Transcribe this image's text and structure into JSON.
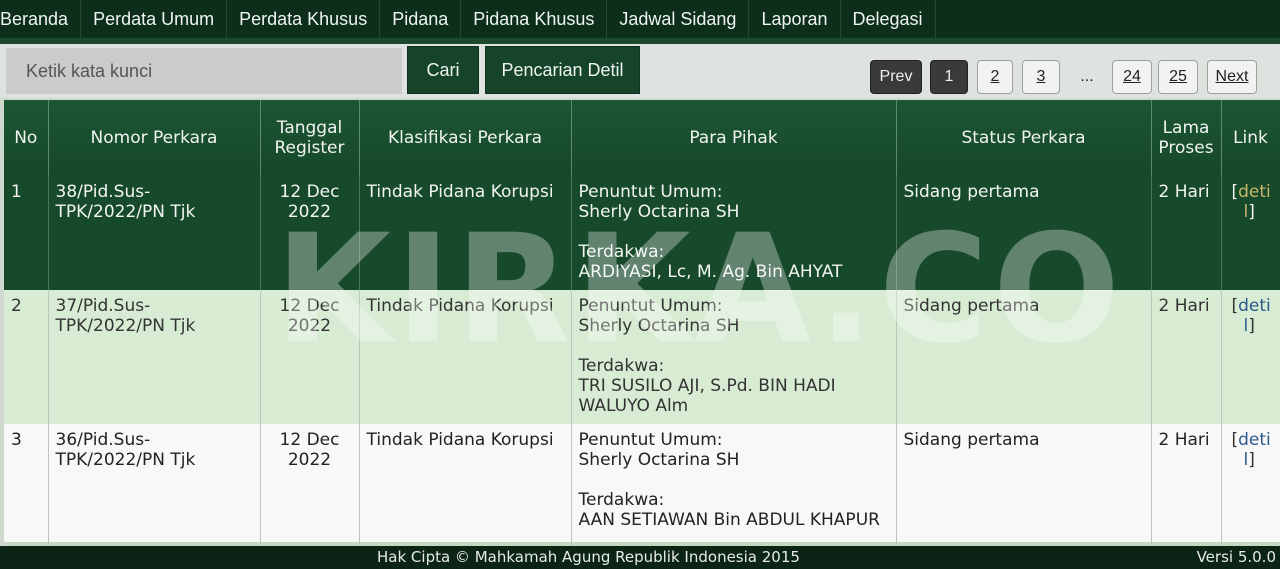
{
  "nav": {
    "items": [
      "Beranda",
      "Perdata Umum",
      "Perdata Khusus",
      "Pidana",
      "Pidana Khusus",
      "Jadwal Sidang",
      "Laporan",
      "Delegasi"
    ]
  },
  "search": {
    "placeholder": "Ketik kata kunci",
    "cari_label": "Cari",
    "detail_label": "Pencarian Detil"
  },
  "pagination": {
    "prev": "Prev",
    "pages": [
      "1",
      "2",
      "3"
    ],
    "ellipsis": "...",
    "last_pages": [
      "24",
      "25"
    ],
    "next": "Next",
    "current": "1"
  },
  "table": {
    "headers": [
      "No",
      "Nomor Perkara",
      "Tanggal Register",
      "Klasifikasi Perkara",
      "Para Pihak",
      "Status Perkara",
      "Lama Proses",
      "Link"
    ],
    "rows": [
      {
        "no": "1",
        "nomor_1": "38/Pid.Sus-",
        "nomor_2": "TPK/2022/PN Tjk",
        "tanggal_1": "12 Dec",
        "tanggal_2": "2022",
        "klasifikasi": "Tindak Pidana Korupsi",
        "penuntut_label": "Penuntut Umum:",
        "penuntut": "Sherly Octarina SH",
        "terdakwa_label": "Terdakwa:",
        "terdakwa_1": "ARDIYASI, Lc, M. Ag. Bin AHYAT",
        "terdakwa_2": "",
        "status": "Sidang pertama",
        "lama": "2 Hari",
        "link_open": "[",
        "link_1": "deti",
        "link_2": "l",
        "link_close": "]"
      },
      {
        "no": "2",
        "nomor_1": "37/Pid.Sus-",
        "nomor_2": "TPK/2022/PN Tjk",
        "tanggal_1": "12 Dec",
        "tanggal_2": "2022",
        "klasifikasi": "Tindak Pidana Korupsi",
        "penuntut_label": "Penuntut Umum:",
        "penuntut": "Sherly Octarina SH",
        "terdakwa_label": "Terdakwa:",
        "terdakwa_1": "TRI SUSILO AJI, S.Pd. BIN HADI",
        "terdakwa_2": "WALUYO Alm",
        "status": "Sidang pertama",
        "lama": "2 Hari",
        "link_open": "[",
        "link_1": "deti",
        "link_2": "l",
        "link_close": "]"
      },
      {
        "no": "3",
        "nomor_1": "36/Pid.Sus-",
        "nomor_2": "TPK/2022/PN Tjk",
        "tanggal_1": "12 Dec",
        "tanggal_2": "2022",
        "klasifikasi": "Tindak Pidana Korupsi",
        "penuntut_label": "Penuntut Umum:",
        "penuntut": "Sherly Octarina SH",
        "terdakwa_label": "Terdakwa:",
        "terdakwa_1": "AAN SETIAWAN Bin ABDUL KHAPUR",
        "terdakwa_2": "",
        "status": "Sidang pertama",
        "lama": "2 Hari",
        "link_open": "[",
        "link_1": "deti",
        "link_2": "l",
        "link_close": "]"
      }
    ]
  },
  "watermark": "KIRKA.CO",
  "footer": {
    "copyright": "Hak Cipta © Mahkamah Agung Republik Indonesia 2015",
    "version": "Versi 5.0.0"
  }
}
